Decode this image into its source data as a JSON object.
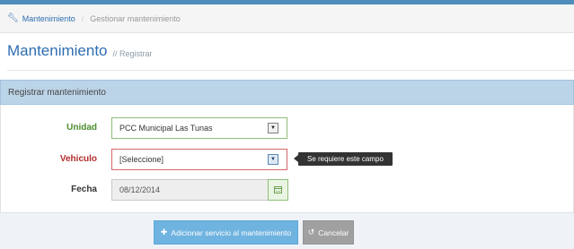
{
  "breadcrumb": {
    "icon": "wrench-icon",
    "link_label": "Mantenimiento",
    "current_label": "Gestionar mantenimiento"
  },
  "header": {
    "title": "Mantenimiento",
    "subtitle": "// Registrar"
  },
  "panel": {
    "title": "Registrar mantenimiento"
  },
  "form": {
    "unidad": {
      "label": "Unidad",
      "value": "PCC Municipal Las Tunas"
    },
    "vehiculo": {
      "label": "Vehiculo",
      "value": "[Seleccione]",
      "error": "Se requiere este campo"
    },
    "fecha": {
      "label": "Fecha",
      "value": "08/12/2014"
    }
  },
  "actions": {
    "submit_label": "Adicionar servicio al mantenimiento",
    "cancel_label": "Cancelar"
  },
  "colors": {
    "accent": "#2e6eb1",
    "valid": "#4c8c2e",
    "error": "#b22d2d",
    "panel_header": "#bcd4e8",
    "primary_button": "#6fb3e0",
    "cancel_button": "#a0a0a0"
  }
}
